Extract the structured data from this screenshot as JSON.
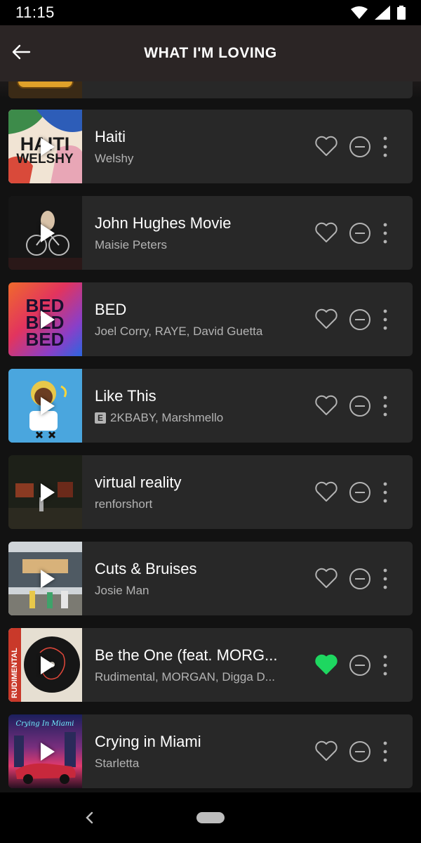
{
  "status_bar": {
    "time": "11:15"
  },
  "header": {
    "title": "WHAT I'M LOVING",
    "back_icon": "arrow-left-icon"
  },
  "colors": {
    "accent_green": "#1ed760",
    "card_bg": "#282828",
    "secondary_text": "#b3b3b3"
  },
  "tracks": [
    {
      "title": "Haiti",
      "artist": "Welshy",
      "explicit": false,
      "liked": false
    },
    {
      "title": "John Hughes Movie",
      "artist": "Maisie Peters",
      "explicit": false,
      "liked": false
    },
    {
      "title": "BED",
      "artist": "Joel Corry, RAYE, David Guetta",
      "explicit": false,
      "liked": false
    },
    {
      "title": "Like This",
      "artist": "2KBABY, Marshmello",
      "explicit": true,
      "explicit_label": "E",
      "liked": false
    },
    {
      "title": "virtual reality",
      "artist": "renforshort",
      "explicit": false,
      "liked": false
    },
    {
      "title": "Cuts & Bruises",
      "artist": "Josie Man",
      "explicit": false,
      "liked": false
    },
    {
      "title": "Be the One (feat. MORG...",
      "artist": "Rudimental, MORGAN, Digga D...",
      "explicit": false,
      "liked": true
    },
    {
      "title": "Crying in Miami",
      "artist": "Starletta",
      "explicit": false,
      "liked": false
    }
  ],
  "art_texts": {
    "haiti": [
      "HAITI",
      "WELSHY"
    ],
    "bed": [
      "BED",
      "BED",
      "BED"
    ],
    "rudimental": "RUDIMENTAL",
    "miami": "Crying In Miami"
  }
}
